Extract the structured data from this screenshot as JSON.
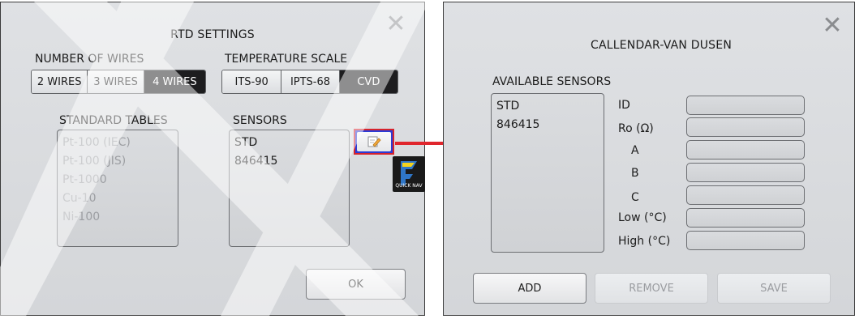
{
  "rtd_settings": {
    "title": "RTD SETTINGS",
    "number_of_wires": {
      "label": "NUMBER OF WIRES",
      "options": [
        "2 WIRES",
        "3 WIRES",
        "4 WIRES"
      ],
      "selected": "4 WIRES"
    },
    "temperature_scale": {
      "label": "TEMPERATURE SCALE",
      "options": [
        "ITS-90",
        "IPTS-68",
        "CVD"
      ],
      "selected": "CVD"
    },
    "standard_tables": {
      "label": "STANDARD TABLES",
      "items": [
        "Pt-100 (IEC)",
        "Pt-100 (JIS)",
        "Pt-1000",
        "Cu-10",
        "Ni-100"
      ]
    },
    "sensors": {
      "label": "SENSORS",
      "items": [
        "STD",
        "846415"
      ]
    },
    "ok_label": "OK",
    "quick_nav_label": "QUICK NAV"
  },
  "cvd_dialog": {
    "title": "CALLENDAR-VAN DUSEN",
    "available_sensors_label": "AVAILABLE SENSORS",
    "sensors": [
      "STD",
      "846415"
    ],
    "fields": [
      {
        "label": "ID",
        "value": ""
      },
      {
        "label": "Ro (Ω)",
        "value": ""
      },
      {
        "label": "A",
        "value": ""
      },
      {
        "label": "B",
        "value": ""
      },
      {
        "label": "C",
        "value": ""
      },
      {
        "label": "Low (°C)",
        "value": ""
      },
      {
        "label": "High (°C)",
        "value": ""
      }
    ],
    "add_label": "ADD",
    "remove_label": "REMOVE",
    "save_label": "SAVE"
  },
  "colors": {
    "highlight_border": "#d6232d",
    "arrow": "#e0262d",
    "selected_segment": "#1d1d1f"
  }
}
